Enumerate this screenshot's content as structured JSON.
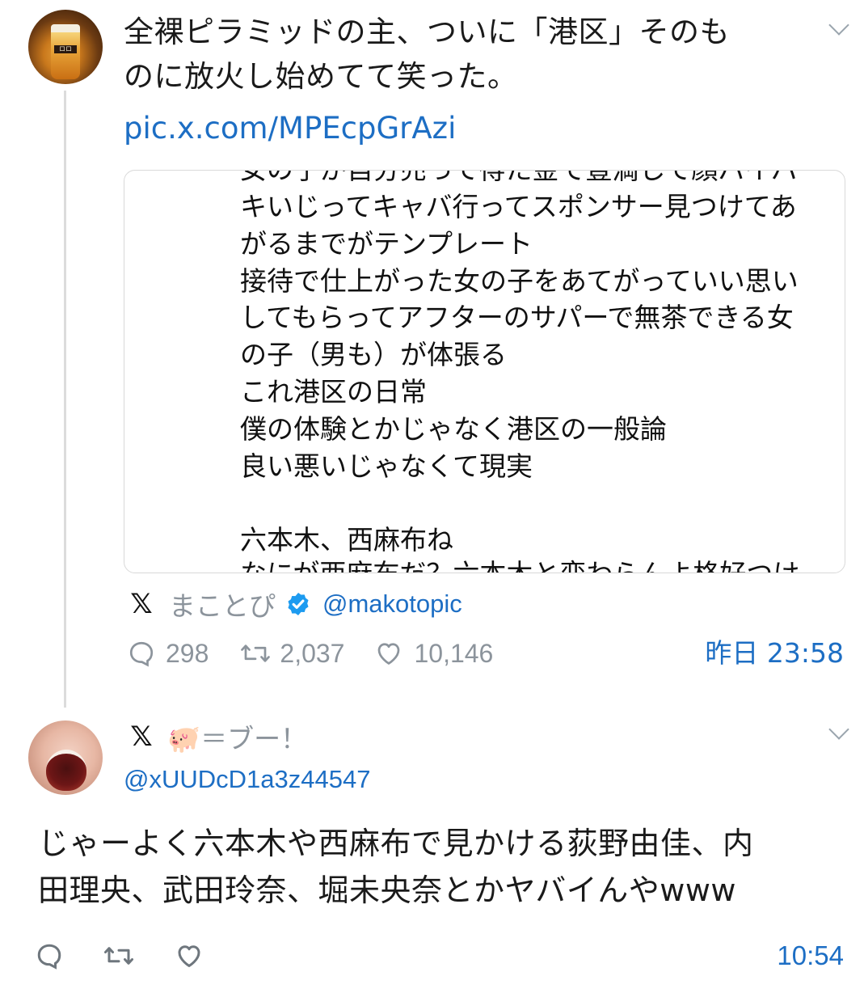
{
  "tweet": {
    "text_line1": "全裸ピラミッドの主、ついに「港区」そのも",
    "text_line2": "のに放火し始めてて笑った。",
    "link": "pic.x.com/MPEcpGrAzi",
    "embed": {
      "cut_top_line": "女の子が自分売って得た金で豊満して顔パイパ",
      "lines": [
        "キいじってキャバ行ってスポンサー見つけてあ",
        "がるまでがテンプレート",
        "接待で仕上がった女の子をあてがっていい思い",
        "してもらってアフターのサパーで無茶できる女",
        "の子（男も）が体張る",
        "これ港区の日常",
        "僕の体験とかじゃなく港区の一般論",
        "良い悪いじゃなくて現実",
        "",
        "六本木、西麻布ね"
      ],
      "cut_bottom_line": "なにが西麻布だ？六本木と変わらんよ格好つけ"
    },
    "platform_icon": "x-logo-icon",
    "author_name": "まことぴ",
    "author_handle": "@makotopic",
    "verified_color": "#1d9bf0",
    "replies": "298",
    "retweets": "2,037",
    "likes": "10,146",
    "time": "昨日 23:58"
  },
  "reply": {
    "platform_icon": "x-logo-icon",
    "author_name": "🐖＝ブー！",
    "author_handle": "@xUUDcD1a3z44547",
    "text_line1": "じゃーよく六本木や西麻布で見かける荻野由佳、内",
    "text_line2": "田理央、武田玲奈、堀未央奈とかヤバイんやwww",
    "time": "10:54"
  },
  "colors": {
    "link": "#1d6ec4",
    "muted": "#8c949c",
    "border": "#d9d9d9"
  }
}
